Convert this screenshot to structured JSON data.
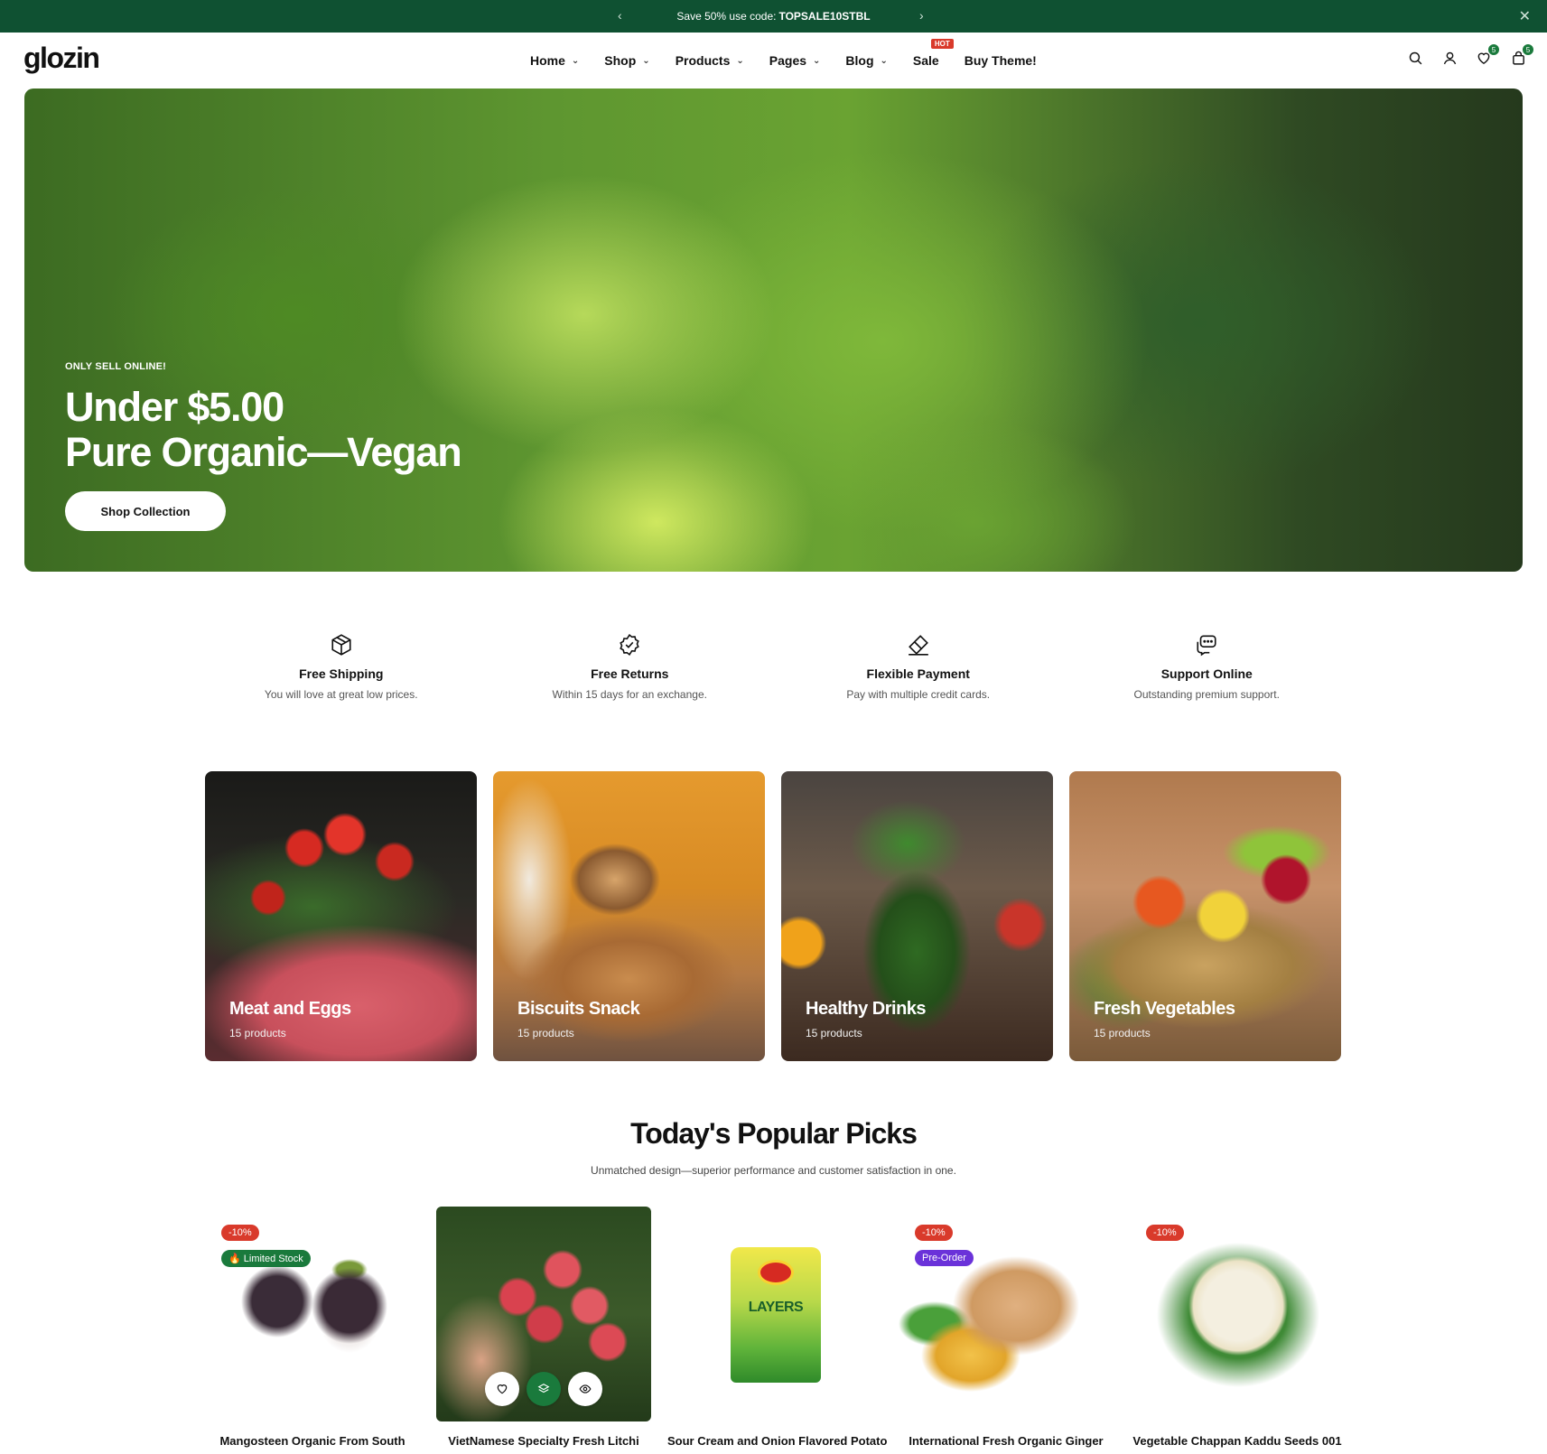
{
  "announcement": {
    "text": "Save 50% use code:",
    "code": "TOPSALE10STBL",
    "prev_icon": "chevron-left-icon",
    "next_icon": "chevron-right-icon",
    "close_icon": "close-icon"
  },
  "header": {
    "logo": "glozin",
    "nav": [
      {
        "label": "Home",
        "dropdown": true
      },
      {
        "label": "Shop",
        "dropdown": true
      },
      {
        "label": "Products",
        "dropdown": true
      },
      {
        "label": "Pages",
        "dropdown": true
      },
      {
        "label": "Blog",
        "dropdown": true
      },
      {
        "label": "Sale",
        "dropdown": false,
        "badge": "HOT"
      },
      {
        "label": "Buy Theme!",
        "dropdown": false
      }
    ],
    "icons": [
      "search-icon",
      "account-icon",
      "wishlist-icon",
      "cart-icon"
    ],
    "wishlist_count": "5",
    "cart_count": "5"
  },
  "hero": {
    "tag": "ONLY SELL ONLINE!",
    "title_line1": "Under $5.00",
    "title_line2": "Pure Organic—Vegan",
    "button": "Shop Collection"
  },
  "features": [
    {
      "icon": "box-icon",
      "title": "Free Shipping",
      "desc": "You will love at great low prices."
    },
    {
      "icon": "badge-check-icon",
      "title": "Free Returns",
      "desc": "Within 15 days for an exchange."
    },
    {
      "icon": "payment-icon",
      "title": "Flexible Payment",
      "desc": "Pay with multiple credit cards."
    },
    {
      "icon": "chat-icon",
      "title": "Support Online",
      "desc": "Outstanding premium support."
    }
  ],
  "categories": [
    {
      "name": "Meat and Eggs",
      "count": "15 products"
    },
    {
      "name": "Biscuits Snack",
      "count": "15 products"
    },
    {
      "name": "Healthy Drinks",
      "count": "15 products"
    },
    {
      "name": "Fresh Vegetables",
      "count": "15 products"
    }
  ],
  "popular": {
    "title": "Today's Popular Picks",
    "subtitle": "Unmatched design—superior performance and customer satisfaction in one.",
    "products": [
      {
        "name": "Mangosteen Organic From South",
        "sale": "-10%",
        "tag": "🔥 Limited Stock"
      },
      {
        "name": "VietNamese Specialty Fresh Litchi",
        "sale": "",
        "tag": ""
      },
      {
        "name": "Sour Cream and Onion Flavored Potato",
        "sale": "",
        "tag": ""
      },
      {
        "name": "International Fresh Organic Ginger",
        "sale": "-10%",
        "tag": "Pre-Order"
      },
      {
        "name": "Vegetable Chappan Kaddu Seeds 001",
        "sale": "-10%",
        "tag": ""
      }
    ],
    "chip_brand": "lay's",
    "chip_name": "LAYERS"
  },
  "colors": {
    "brand_green": "#0f5132",
    "accent_green": "#1a7a3c",
    "sale_red": "#d93a2b",
    "preorder_purple": "#6a32d9"
  }
}
